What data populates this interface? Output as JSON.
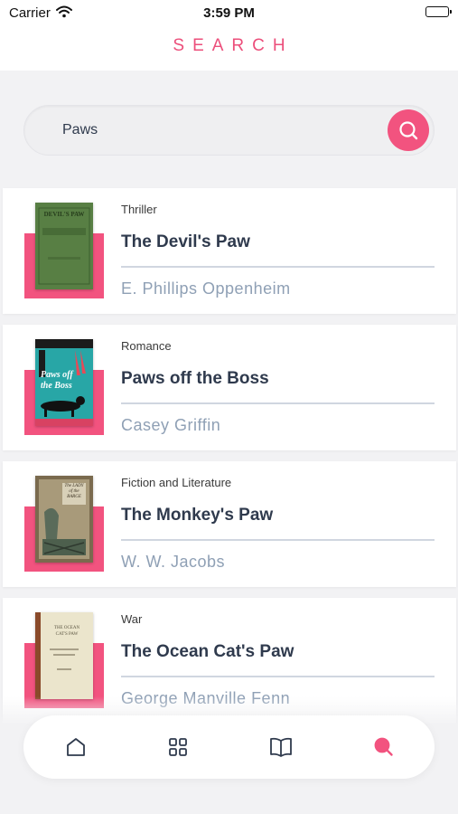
{
  "status_bar": {
    "carrier": "Carrier",
    "time": "3:59 PM"
  },
  "header": {
    "title": "SEARCH"
  },
  "search": {
    "value": "Paws",
    "placeholder": ""
  },
  "colors": {
    "accent": "#f2537f",
    "title": "#2f3a4d",
    "author": "#8fa0b5"
  },
  "results": [
    {
      "genre": "Thriller",
      "title": "The Devil's Paw",
      "author": "E. Phillips Oppenheim",
      "cover_text": "DEVIL'S PAW"
    },
    {
      "genre": "Romance",
      "title": "Paws off the Boss",
      "author": "Casey Griffin",
      "cover_text": "Paws off the Boss"
    },
    {
      "genre": "Fiction and Literature",
      "title": "The Monkey's Paw",
      "author": "W. W. Jacobs",
      "cover_text": "The LADY of the BARGE"
    },
    {
      "genre": "War",
      "title": "The Ocean Cat's Paw",
      "author": "George Manville Fenn",
      "cover_text": "THE OCEAN CAT'S PAW"
    }
  ],
  "nav": {
    "items": [
      "home-icon",
      "grid-icon",
      "book-icon",
      "search-icon"
    ],
    "active": "search-icon"
  }
}
